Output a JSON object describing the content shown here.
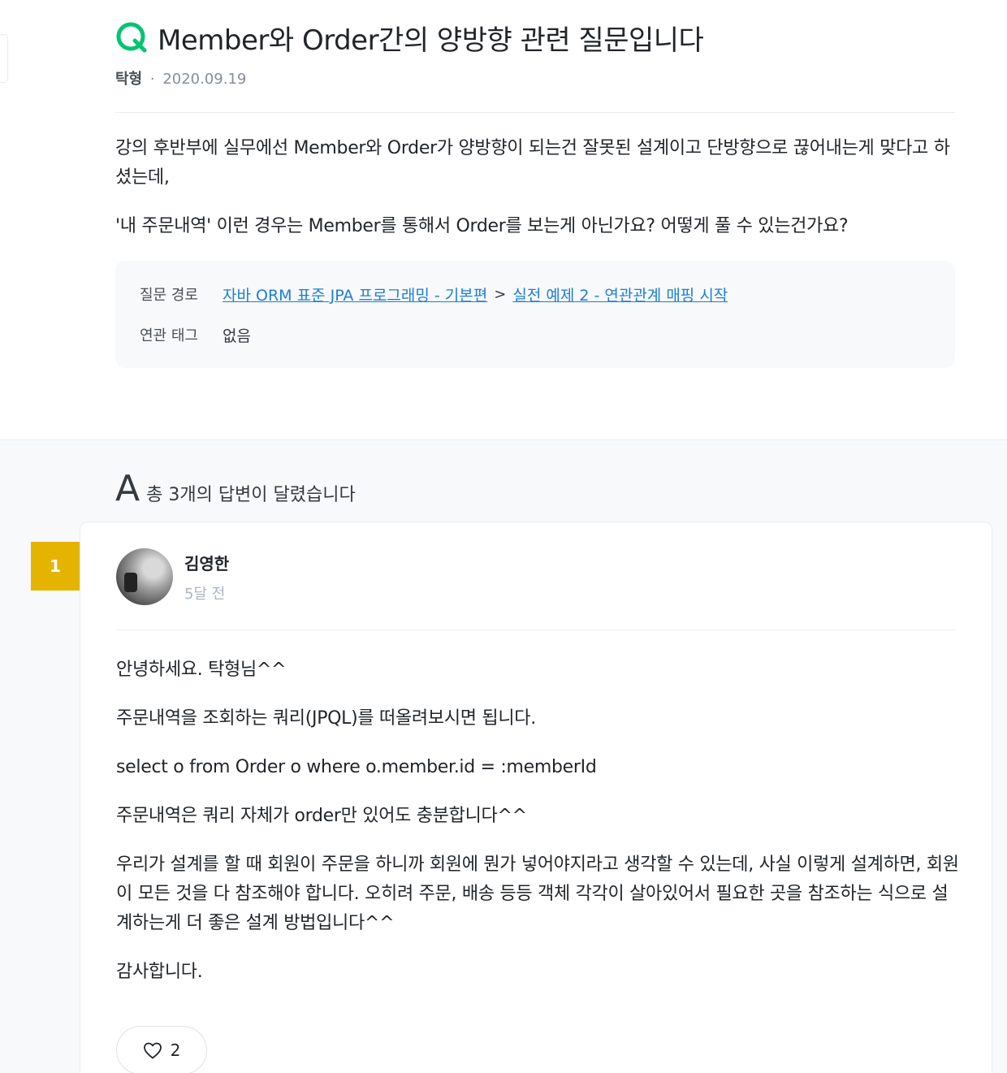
{
  "question": {
    "title": "Member와 Order간의 양방향 관련 질문입니다",
    "author": "탁형",
    "separator": "·",
    "date": "2020.09.19",
    "paragraphs": [
      "강의 후반부에 실무에선 Member와 Order가 양방향이 되는건 잘못된 설계이고 단방향으로 끊어내는게 맞다고 하셨는데,",
      "'내 주문내역' 이런 경우는 Member를 통해서 Order를 보는게 아닌가요? 어떻게 풀 수 있는건가요?"
    ],
    "path_label": "질문 경로",
    "path_course": "자바 ORM 표준 JPA 프로그래밍 - 기본편",
    "path_separator": ">",
    "path_lecture": "실전 예제 2 - 연관관계 매핑 시작",
    "tags_label": "연관 태그",
    "tags_value": "없음"
  },
  "answers": {
    "letter": "A",
    "count_text": "총 3개의 답변이 달렸습니다",
    "items": [
      {
        "rank": "1",
        "author": "김영한",
        "time": "5달 전",
        "paragraphs": [
          "안녕하세요. 탁형님^^",
          "주문내역을 조회하는 쿼리(JPQL)를 떠올려보시면 됩니다.",
          "select o from Order o where o.member.id = :memberId",
          "주문내역은 쿼리 자체가 order만 있어도 충분합니다^^",
          "우리가 설계를 할 때 회원이 주문을 하니까 회원에 뭔가 넣어야지라고 생각할 수 있는데, 사실 이렇게 설계하면, 회원이 모든 것을 다 참조해야 합니다. 오히려 주문, 배송 등등 객체 각각이 살아있어서 필요한 곳을 참조하는 식으로 설계하는게 더 좋은 설계 방법입니다^^",
          "감사합니다."
        ],
        "likes": "2"
      }
    ]
  },
  "icons": {
    "question": "q-icon",
    "like": "heart-icon"
  },
  "colors": {
    "brand_green": "#00c471",
    "rank_gold": "#e5b400",
    "link_blue": "#1c7ed6"
  }
}
